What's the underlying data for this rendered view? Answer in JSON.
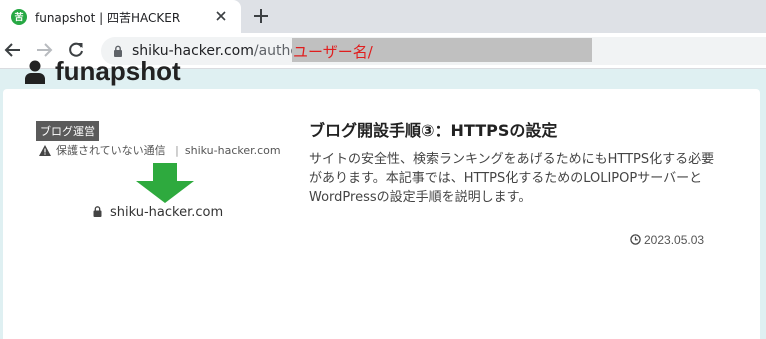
{
  "browser": {
    "tab": {
      "title": "funapshot | 四苦HACKER",
      "favicon_icon": "site-favicon-icon",
      "favicon_glyph": "苦"
    },
    "address_bar": {
      "host": "shiku-hacker.com",
      "path": "/author/",
      "highlighted_placeholder": "ユーザー名/",
      "highlight_color": "#e01e1e"
    }
  },
  "page": {
    "author_icon": "user-icon",
    "author_name": "funapshot",
    "post": {
      "thumbnail": {
        "badge": "ブログ運営",
        "warning_text": "保護されていない通信",
        "separator": "|",
        "warning_host": "shiku-hacker.com",
        "secure_host": "shiku-hacker.com",
        "arrow_color": "#2eaa3e"
      },
      "title": "ブログ開設手順③：HTTPSの設定",
      "excerpt": "サイトの安全性、検索ランキングをあげるためにもHTTPS化する必要があります。本記事では、HTTPS化するためのLOLIPOPサーバーとWordPressの設定手順を説明します。",
      "date": "2023.05.03"
    }
  },
  "colors": {
    "page_background": "#dff0f2",
    "card_background": "#ffffff"
  }
}
